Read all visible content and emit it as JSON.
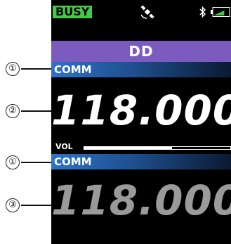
{
  "status": {
    "busy": "BUSY",
    "battery_level": 0.7,
    "icons": [
      "gps-icon",
      "bluetooth-icon",
      "battery-icon"
    ]
  },
  "mode": {
    "label": "DD"
  },
  "band_a": {
    "label": "COMM",
    "frequency": "118.000"
  },
  "volume": {
    "label": "VOL",
    "level": 0.6
  },
  "band_b": {
    "label": "COMM",
    "frequency": "118.000"
  },
  "callouts": [
    "①",
    "②",
    "①",
    "③"
  ],
  "colors": {
    "busy": "#46c846",
    "mode_bar": "#7b5bbd",
    "band_bar": "#2d73c8",
    "freq_a": "#ffffff",
    "freq_b": "#9a9a9a"
  }
}
